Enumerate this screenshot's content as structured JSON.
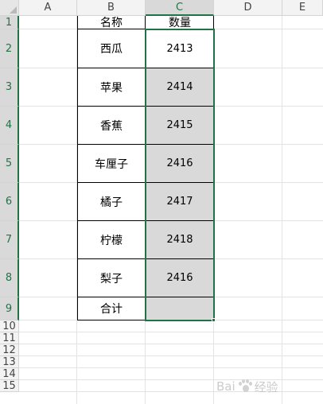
{
  "columns": [
    "A",
    "B",
    "C",
    "D",
    "E"
  ],
  "rows": [
    "1",
    "2",
    "3",
    "4",
    "5",
    "6",
    "7",
    "8",
    "9",
    "10",
    "11",
    "12",
    "13",
    "14",
    "15"
  ],
  "table": {
    "header": {
      "name": "名称",
      "qty": "数量"
    },
    "items": [
      {
        "name": "西瓜",
        "qty": "2413"
      },
      {
        "name": "苹果",
        "qty": "2414"
      },
      {
        "name": "香蕉",
        "qty": "2415"
      },
      {
        "name": "车厘子",
        "qty": "2416"
      },
      {
        "name": "橘子",
        "qty": "2417"
      },
      {
        "name": "柠檬",
        "qty": "2418"
      },
      {
        "name": "梨子",
        "qty": "2416"
      }
    ],
    "total": {
      "name": "合计",
      "qty": ""
    }
  },
  "selection": {
    "column": "C",
    "rows": [
      "1",
      "2",
      "3",
      "4",
      "5",
      "6",
      "7",
      "8",
      "9"
    ],
    "active_cell": "C2"
  },
  "watermark": {
    "text_left": "Bai",
    "text_right": "经验"
  },
  "colors": {
    "accent": "#217346",
    "selection_fill": "#d9d9d9",
    "header_bg": "#f3f3f3"
  }
}
